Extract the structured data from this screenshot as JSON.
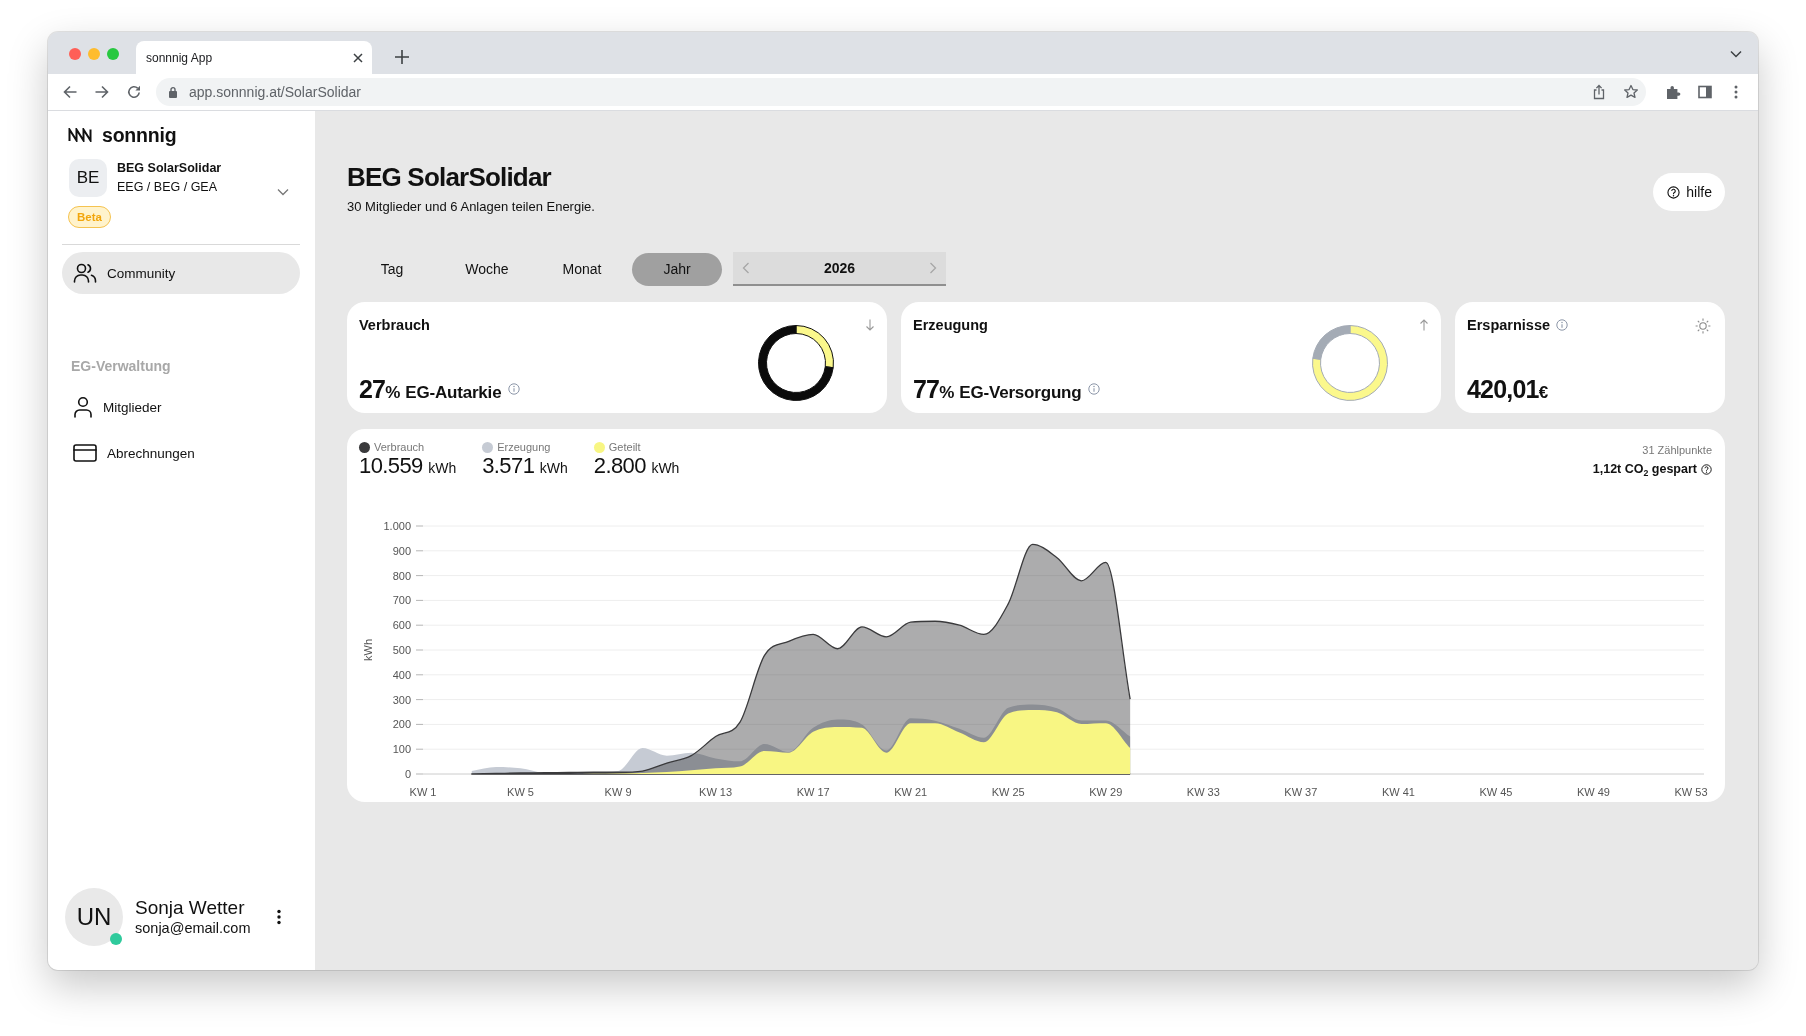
{
  "browser": {
    "tab_title": "sonnnig App",
    "url": "app.sonnnig.at/SolarSolidar"
  },
  "sidebar": {
    "logo": "sonnnig",
    "organization": {
      "initials": "BE",
      "name": "BEG SolarSolidar",
      "type": "EEG / BEG / GEA",
      "badge": "Beta"
    },
    "nav": [
      {
        "label": "Community",
        "selected": true
      }
    ],
    "sections": [
      {
        "title": "EG-Verwaltung",
        "items": [
          {
            "label": "Mitglieder",
            "selected": false
          },
          {
            "label": "Abrechnungen",
            "selected": false
          }
        ]
      }
    ],
    "user": {
      "initials": "UN",
      "name": "Sonja Wetter",
      "email": "sonja@email.com",
      "online": true
    }
  },
  "header": {
    "title": "BEG SolarSolidar",
    "subtitle": "30 Mitglieder und 6 Anlagen teilen Energie.",
    "help_button": "hilfe"
  },
  "period_tabs": [
    {
      "label": "Tag",
      "selected": false
    },
    {
      "label": "Woche",
      "selected": false
    },
    {
      "label": "Monat",
      "selected": false
    },
    {
      "label": "Jahr",
      "selected": true
    }
  ],
  "year_selector": {
    "value": "2026",
    "previous_disabled": true,
    "next_disabled": true
  },
  "cards": [
    {
      "kind": "consumption",
      "title": "Verbrauch",
      "value": "27",
      "unit": "%",
      "label": "EG-Autarkie",
      "chart_data": {
        "type": "donut",
        "values": [
          27,
          73
        ]
      }
    },
    {
      "kind": "generation",
      "title": "Erzeugung",
      "value": "77",
      "unit": "%",
      "label": "EG-Versorgung",
      "chart_data": {
        "type": "donut",
        "values": [
          77,
          23
        ]
      }
    },
    {
      "kind": "savings",
      "title": "Ersparnisse",
      "value": "420,01",
      "unit": "€"
    }
  ],
  "energy_chart": {
    "totals": [
      {
        "value": "10.559",
        "unit": "kWh"
      },
      {
        "value": "3.571",
        "unit": "kWh"
      },
      {
        "value": "2.800",
        "unit": "kWh"
      }
    ],
    "meter_count": "31 Zählpunkte",
    "co2_saved": "1,12t CO$_{2}$ gespart",
    "chart_data": {
      "type": "area",
      "ylabel": "kWh",
      "grid": true,
      "categories": [
        "KW 1",
        null,
        null,
        null,
        "KW 5",
        null,
        null,
        null,
        "KW 9",
        null,
        null,
        null,
        "KW 13",
        null,
        null,
        null,
        "KW 17",
        null,
        null,
        null,
        "KW 21",
        null,
        null,
        null,
        "KW 25",
        null,
        null,
        null,
        "KW 29",
        null,
        null,
        null,
        "KW 33",
        null,
        null,
        null,
        "KW 37",
        null,
        null,
        null,
        "KW 41",
        null,
        null,
        null,
        "KW 45",
        null,
        null,
        null,
        "KW 49",
        null,
        null,
        null,
        "KW 53"
      ],
      "ylim": [
        0,
        1000
      ],
      "yticks": [
        0,
        100,
        200,
        300,
        400,
        500,
        600,
        700,
        800,
        900,
        {
          "value": 1000,
          "label": "1.000"
        }
      ],
      "series": [
        {
          "name": "Verbrauch",
          "color": "#3a3a3c",
          "values": [
            null,
            null,
            0,
            2,
            4,
            5,
            6,
            7,
            7,
            12,
            44,
            74,
            151,
            209,
            477,
            535,
            563,
            505,
            593,
            553,
            612,
            616,
            600,
            563,
            686,
            926,
            872,
            779,
            853,
            302,
            null,
            null,
            null,
            null,
            null,
            null,
            null,
            null,
            null,
            null,
            null,
            null,
            null,
            null,
            null,
            null,
            null,
            null,
            null,
            null,
            null,
            null,
            null
          ]
        },
        {
          "name": "Erzeugung",
          "color": "#c6cbd4",
          "values": [
            null,
            null,
            12,
            28,
            23,
            5,
            5,
            7,
            12,
            105,
            74,
            86,
            63,
            51,
            121,
            88,
            186,
            220,
            200,
            95,
            225,
            215,
            182,
            146,
            267,
            280,
            265,
            216,
            216,
            151,
            null,
            null,
            null,
            null,
            null,
            null,
            null,
            null,
            null,
            null,
            null,
            null,
            null,
            null,
            null,
            null,
            null,
            null,
            null,
            null,
            null,
            null,
            null
          ]
        },
        {
          "name": "Geteilt",
          "color": "#f8f683",
          "values": [
            null,
            null,
            0,
            0,
            0,
            0,
            0,
            1,
            2,
            4,
            8,
            15,
            23,
            30,
            93,
            86,
            170,
            190,
            186,
            86,
            205,
            205,
            167,
            128,
            244,
            258,
            249,
            202,
            205,
            105,
            null,
            null,
            null,
            null,
            null,
            null,
            null,
            null,
            null,
            null,
            null,
            null,
            null,
            null,
            null,
            null,
            null,
            null,
            null,
            null,
            null,
            null,
            null
          ]
        }
      ]
    }
  }
}
